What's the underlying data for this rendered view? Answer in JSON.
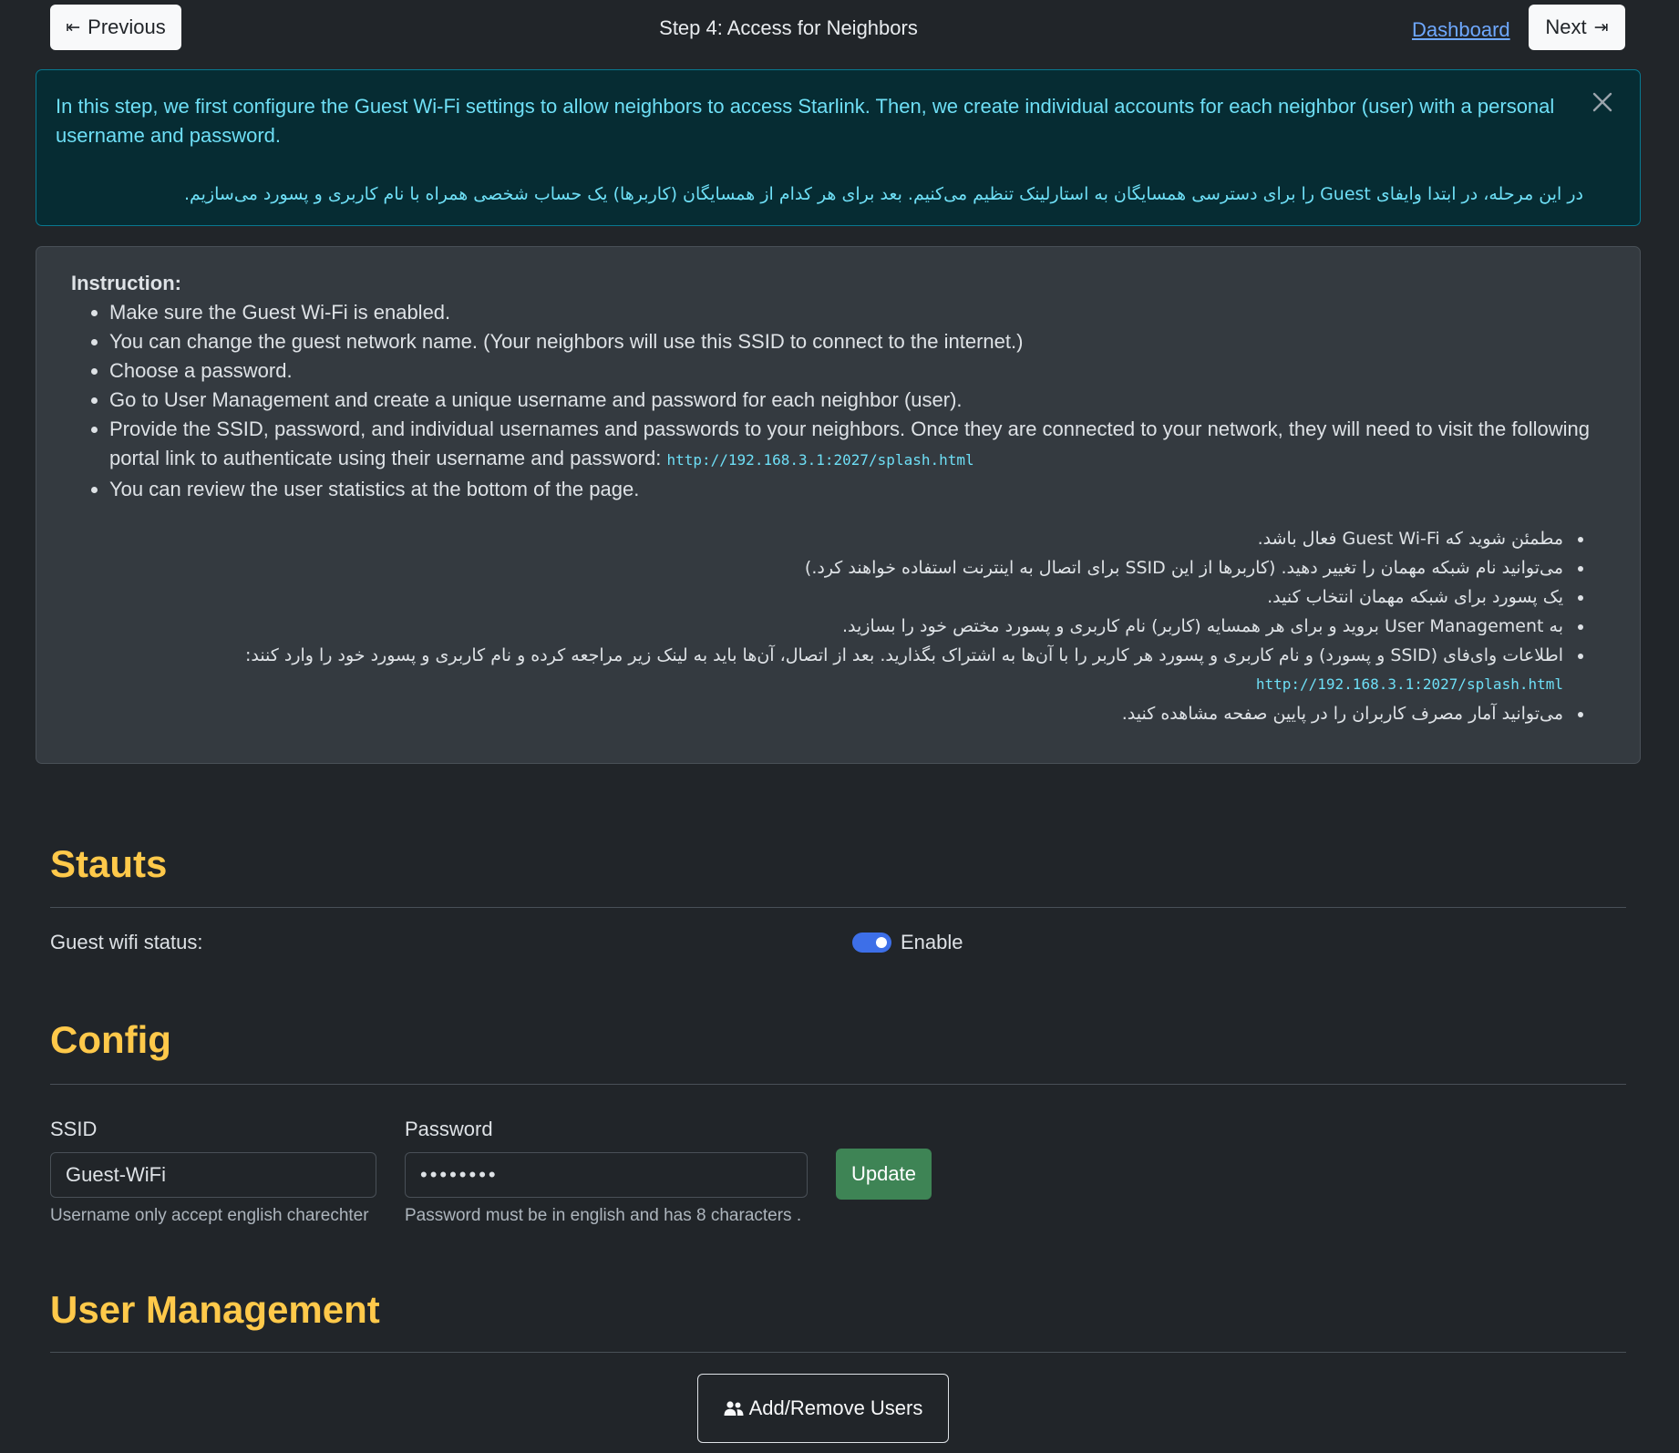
{
  "nav": {
    "previous_label": "Previous",
    "previous_icon": "arrow-bar-left-icon",
    "step_title": "Step 4: Access for Neighbors",
    "dashboard_link": "Dashboard",
    "next_label": "Next",
    "next_icon": "arrow-bar-right-icon"
  },
  "alert": {
    "text_en": "In this step, we first configure the Guest Wi-Fi settings to allow neighbors to access Starlink. Then, we create individual accounts for each neighbor (user) with a personal username and password.",
    "text_fa": "در این مرحله، در ابتدا وایفای Guest را برای دسترسی همسایگان به استارلینک تنظیم می‌کنیم. بعد برای هر کدام از همسایگان (کاربرها) یک حساب شخصی همراه با نام کاربری و پسورد می‌سازیم.",
    "close_icon": "close-icon",
    "color": "#6edff6"
  },
  "instruction": {
    "heading": "Instruction:",
    "items_en": [
      "Make sure the Guest Wi-Fi is enabled.",
      "You can change the guest network name. (Your neighbors will use this SSID to connect to the internet.)",
      "Choose a password.",
      "Go to User Management and create a unique username and password for each neighbor (user).",
      "Provide the SSID, password, and individual usernames and passwords to your neighbors. Once they are connected to your network, they will need to visit the following portal link to authenticate using their username and password:",
      "You can review the user statistics at the bottom of the page."
    ],
    "portal_url": "http://192.168.3.1:2027/splash.html",
    "items_fa": [
      "مطمئن شوید که Guest Wi-Fi فعال باشد.",
      "می‌توانید نام شبکه مهمان را تغییر دهید. (کاربرها از این SSID برای اتصال به اینترنت استفاده خواهند کرد.)",
      "یک پسورد برای شبکه مهمان انتخاب کنید.",
      "به User Management بروید و برای هر همسایه (کاربر) نام کاربری و پسورد مختص خود را بسازید.",
      "اطلاعات وای‌فای (SSID و پسورد) و نام کاربری و پسورد هر کاربر را با آن‌ها به اشتراک بگذارید. بعد از اتصال، آن‌ها باید به لینک زیر مراجعه کرده و نام کاربری و پسورد خود را وارد کنند:",
      "می‌توانید آمار مصرف کاربران را در پایین صفحه مشاهده کنید."
    ]
  },
  "status": {
    "title": "Stauts",
    "guest_label": "Guest wifi status:",
    "toggle_label": "Enable",
    "enabled": true
  },
  "config": {
    "title": "Config",
    "ssid_label": "SSID",
    "ssid_value": "Guest-WiFi",
    "ssid_help": "Username only accept english charechter",
    "password_label": "Password",
    "password_value": "••••••••",
    "password_help": "Password must be in english and has 8 characters .",
    "update_label": "Update"
  },
  "users": {
    "title": "User Management",
    "button_label": "Add/Remove Users",
    "button_icon": "people-icon"
  },
  "colors": {
    "background": "#212529",
    "section_title": "#ffc94a",
    "toggle_on": "#3d6fe8",
    "update_button": "#3e8455",
    "link": "#6ea8fe"
  }
}
